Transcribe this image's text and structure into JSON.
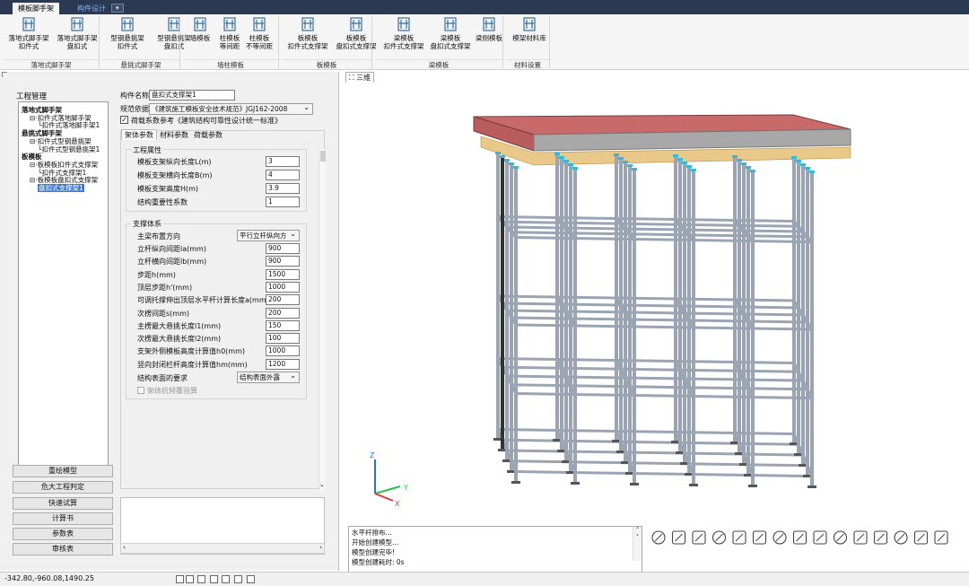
{
  "ribbon_tabs": {
    "main": "模板脚手架",
    "design": "构件设计",
    "menu": "▾"
  },
  "ribbon": {
    "buttons": [
      {
        "label1": "落地式脚手架",
        "label2": "扣件式",
        "icon": "scaffold-icon"
      },
      {
        "label1": "落地式脚手架",
        "label2": "盘扣式",
        "icon": "scaffold-icon"
      },
      {
        "label1": "型钢悬挑架",
        "label2": "扣件式",
        "icon": "cantilever-icon"
      },
      {
        "label1": "型钢悬挑架",
        "label2": "盘扣式",
        "icon": "cantilever-icon"
      },
      {
        "label1": "墙模板",
        "label2": "",
        "icon": "wall-form-icon"
      },
      {
        "label1": "柱模板",
        "label2": "等间距",
        "icon": "column-form-icon"
      },
      {
        "label1": "柱模板",
        "label2": "不等间距",
        "icon": "column-form-icon"
      },
      {
        "label1": "板模板",
        "label2": "扣件式支撑架",
        "icon": "slab-form-icon"
      },
      {
        "label1": "板模板",
        "label2": "盘扣式支撑架",
        "icon": "slab-form-icon"
      },
      {
        "label1": "梁模板",
        "label2": "扣件式支撑架",
        "icon": "beam-form-icon"
      },
      {
        "label1": "梁模板",
        "label2": "盘扣式支撑架",
        "icon": "beam-form-icon"
      },
      {
        "label1": "梁侧模板",
        "label2": "",
        "icon": "beam-side-icon"
      },
      {
        "label1": "模架材料库",
        "label2": "",
        "icon": "material-grid-icon"
      }
    ],
    "groups": [
      "落地式脚手架",
      "悬挑式脚手架",
      "墙柱模板",
      "板模板",
      "梁模板",
      "材料设置"
    ]
  },
  "left": {
    "project_title": "工程管理",
    "tree": [
      {
        "text": "落地式脚手架",
        "bold": true,
        "indent": 0
      },
      {
        "text": "⊟·扣件式落地脚手架",
        "bold": false,
        "indent": 1
      },
      {
        "text": "└扣件式落地脚手架1",
        "bold": false,
        "indent": 2
      },
      {
        "text": "悬挑式脚手架",
        "bold": true,
        "indent": 0
      },
      {
        "text": "⊟·扣件式型钢悬挑架",
        "bold": false,
        "indent": 1
      },
      {
        "text": "└扣件式型钢悬挑架1",
        "bold": false,
        "indent": 2
      },
      {
        "text": "板模板",
        "bold": true,
        "indent": 0
      },
      {
        "text": "⊟·板模板扣件式支撑架",
        "bold": false,
        "indent": 1
      },
      {
        "text": "└扣件式支撑架1",
        "bold": false,
        "indent": 2
      },
      {
        "text": "⊟·板模板盘扣式支撑架",
        "bold": false,
        "indent": 1
      },
      {
        "text": "盘扣式支撑架1",
        "bold": false,
        "indent": 2,
        "selected": true
      }
    ],
    "buttons": [
      "重绘模型",
      "危大工程判定",
      "快速试算",
      "计算书",
      "参数表",
      "审核表"
    ]
  },
  "form": {
    "name_label": "构件名称",
    "name_value": "盘扣式支撑架1",
    "spec_label": "规范依据",
    "spec_value": "《建筑施工模板安全技术规范》JGJ162-2008",
    "load_check": "荷载系数参考《建筑结构可靠性设计统一标准》",
    "tabs": [
      "架体参数",
      "材料参数",
      "荷载参数"
    ],
    "eng_group": "工程属性",
    "eng_rows": [
      {
        "label": "模板支架纵向长度L(m)",
        "value": "3"
      },
      {
        "label": "模板支架横向长度B(m)",
        "value": "4"
      },
      {
        "label": "模板支架高度H(m)",
        "value": "3.9"
      },
      {
        "label": "结构重要性系数",
        "value": "1"
      }
    ],
    "sys_group": "支撑体系",
    "main_beam_label": "主梁布置方向",
    "main_beam_value": "平行立杆纵向方",
    "sys_rows": [
      {
        "label": "立杆纵向间距la(mm)",
        "value": "900"
      },
      {
        "label": "立杆横向间距lb(mm)",
        "value": "900"
      },
      {
        "label": "步距h(mm)",
        "value": "1500"
      },
      {
        "label": "顶层步距h'(mm)",
        "value": "1000"
      },
      {
        "label": "可调托撑伸出顶层水平杆计算长度a(mm)",
        "value": "200"
      },
      {
        "label": "次楞间距s(mm)",
        "value": "200"
      },
      {
        "label": "主楞最大悬挑长度l1(mm)",
        "value": "150"
      },
      {
        "label": "次楞最大悬挑长度l2(mm)",
        "value": "100"
      },
      {
        "label": "支架外侧模板高度计算值h0(mm)",
        "value": "1000"
      },
      {
        "label": "竖向封闭栏杆高度计算值hm(mm)",
        "value": "1200"
      }
    ],
    "surface_label": "结构表面的要求",
    "surface_value": "结构表面外露",
    "antitilt_label": "架体抗倾覆验算"
  },
  "viewport": {
    "tab": "三维",
    "axis_x": "X",
    "axis_y": "Y",
    "axis_z": "Z",
    "colors": {
      "slab": "#c8696a",
      "pipe": "#9aa4b2",
      "timber": "#e8c98a",
      "node": "#36b8d8"
    }
  },
  "log": {
    "lines": [
      "水平杆排布...",
      "开始创建模型...",
      "模型创建完毕!",
      "模型创建耗时: 0s"
    ]
  },
  "status": {
    "coords": "-342.80,-960.08,1490.25"
  }
}
